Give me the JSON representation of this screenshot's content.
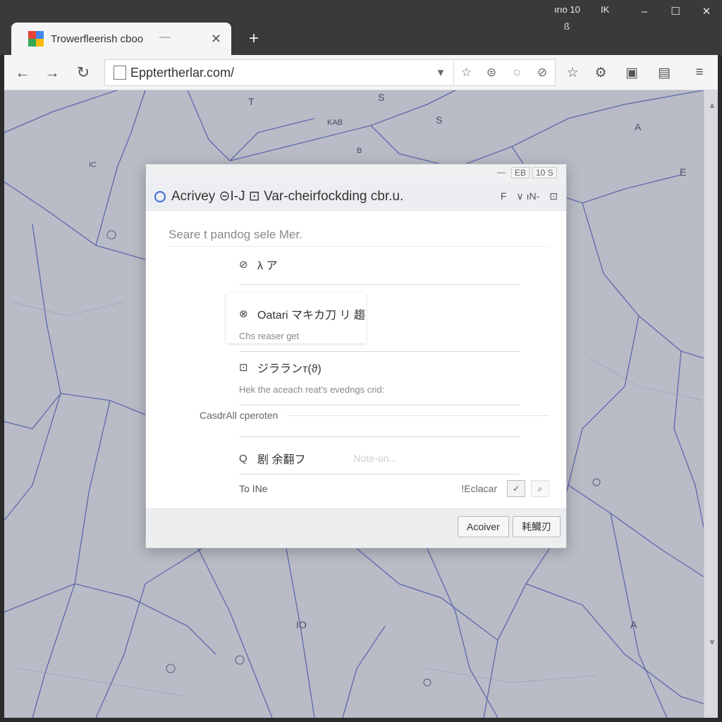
{
  "window": {
    "status_a": "ırıo 10",
    "status_b": "IK",
    "status_c": "ß",
    "minimize": "–",
    "maximize": "☐",
    "close": "✕"
  },
  "tab": {
    "title": "Trowerfleerish cboo",
    "dash": "—",
    "close": "✕",
    "new_tab": "+"
  },
  "toolbar": {
    "back": "←",
    "forward": "→",
    "reload": "↻",
    "url": "Epptertherlar.com/",
    "omni_icons": [
      "▾",
      "☆",
      "⊜",
      "◌",
      "⊘"
    ],
    "right_icons": [
      "☆",
      "⚙",
      "▣",
      "▤",
      "≡"
    ]
  },
  "map": {
    "labels": [
      {
        "text": "T"
      },
      {
        "text": "S"
      },
      {
        "text": "S"
      },
      {
        "text": "A"
      },
      {
        "text": "KAB"
      },
      {
        "text": "B"
      },
      {
        "text": "IO"
      },
      {
        "text": "A"
      },
      {
        "text": "IC"
      },
      {
        "text": "E"
      }
    ]
  },
  "dialog": {
    "mini_a": "EB",
    "mini_b": "10 S",
    "mini_dash": "—",
    "title": "Acrivey ⊝I-J ⊡ Var-cheirfockding cbr.u.",
    "header_right": [
      "F",
      "∨ ıN-",
      "⊡"
    ],
    "search_placeholder": "Seare t pandog sele Mer.",
    "items": [
      {
        "icon": "⊘",
        "label": "λ ア",
        "sub": ""
      },
      {
        "icon": "⊗",
        "label": "Oatari マキカ刀 リ 趨",
        "sub": "Chs reaser get"
      },
      {
        "icon": "⊡",
        "label": "ジラランт(ϑ)",
        "sub": "Hek the aceach reat's evedngs crid:"
      },
      {
        "icon": "Q",
        "label": "剧 余翻フ",
        "sub": ""
      }
    ],
    "section_label": "CasdrAll cperoten",
    "faded_text": "Note-on...",
    "bottom_left": "To INe",
    "bottom_right": "!Eclacar",
    "check_btn": "✓",
    "search_btn": "⌕",
    "buttons": {
      "primary": "Acoiver",
      "secondary": "耗鱵刃"
    }
  }
}
